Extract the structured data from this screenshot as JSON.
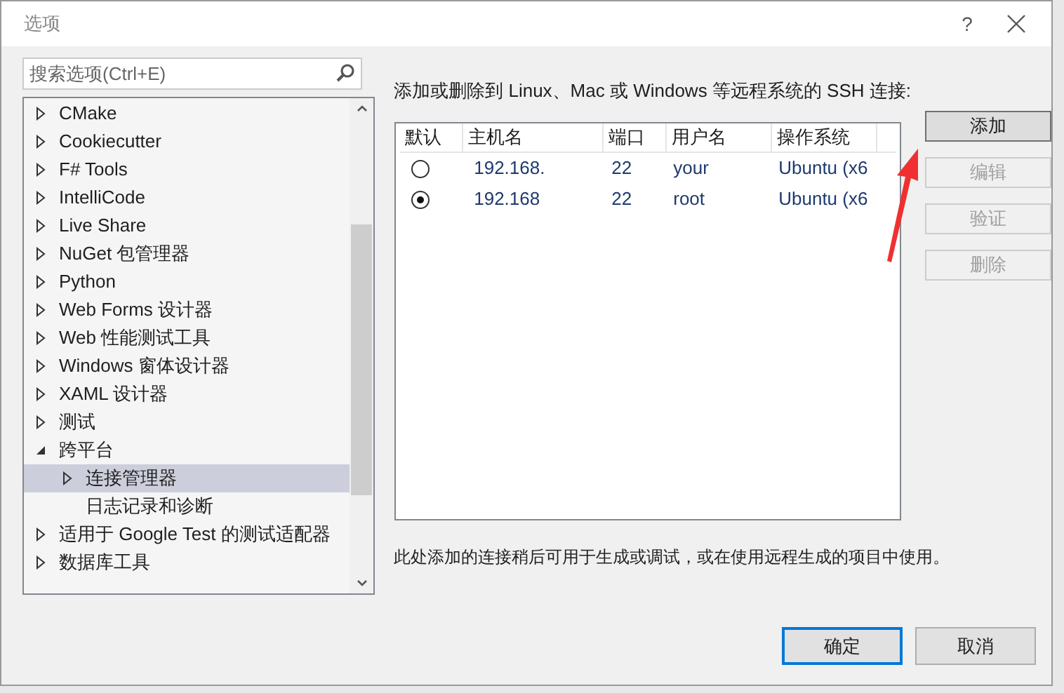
{
  "window": {
    "title": "选项",
    "help": "?"
  },
  "search": {
    "placeholder": "搜索选项(Ctrl+E)"
  },
  "tree": [
    {
      "label": "CMake",
      "kind": "group",
      "expanded": false,
      "selected": false
    },
    {
      "label": "Cookiecutter",
      "kind": "group",
      "expanded": false,
      "selected": false
    },
    {
      "label": "F# Tools",
      "kind": "group",
      "expanded": false,
      "selected": false
    },
    {
      "label": "IntelliCode",
      "kind": "group",
      "expanded": false,
      "selected": false
    },
    {
      "label": "Live Share",
      "kind": "group",
      "expanded": false,
      "selected": false
    },
    {
      "label": "NuGet 包管理器",
      "kind": "group",
      "expanded": false,
      "selected": false
    },
    {
      "label": "Python",
      "kind": "group",
      "expanded": false,
      "selected": false
    },
    {
      "label": "Web Forms 设计器",
      "kind": "group",
      "expanded": false,
      "selected": false
    },
    {
      "label": "Web 性能测试工具",
      "kind": "group",
      "expanded": false,
      "selected": false
    },
    {
      "label": "Windows 窗体设计器",
      "kind": "group",
      "expanded": false,
      "selected": false
    },
    {
      "label": "XAML 设计器",
      "kind": "group",
      "expanded": false,
      "selected": false
    },
    {
      "label": "测试",
      "kind": "group",
      "expanded": false,
      "selected": false
    },
    {
      "label": "跨平台",
      "kind": "group",
      "expanded": true,
      "selected": false,
      "children": [
        {
          "label": "连接管理器",
          "kind": "group",
          "expanded": false,
          "selected": true
        },
        {
          "label": "日志记录和诊断",
          "kind": "leaf",
          "expanded": false,
          "selected": false
        }
      ]
    },
    {
      "label": "适用于 Google Test 的测试适配器",
      "kind": "group",
      "expanded": false,
      "selected": false
    },
    {
      "label": "数据库工具",
      "kind": "group",
      "expanded": false,
      "selected": false
    }
  ],
  "intro": "添加或删除到 Linux、Mac 或 Windows 等远程系统的 SSH 连接:",
  "table": {
    "columns": [
      "默认",
      "主机名",
      "端口",
      "用户名",
      "操作系统"
    ],
    "rows": [
      {
        "selected": false,
        "host": "192.168.",
        "port": "22",
        "user": "your",
        "os": "Ubuntu (x6"
      },
      {
        "selected": true,
        "host": "192.168",
        "port": "22",
        "user": "root",
        "os": "Ubuntu (x6"
      }
    ]
  },
  "side_buttons": [
    {
      "label": "添加",
      "disabled": false
    },
    {
      "label": "编辑",
      "disabled": true
    },
    {
      "label": "验证",
      "disabled": true
    },
    {
      "label": "删除",
      "disabled": true
    }
  ],
  "note": "此处添加的连接稍后可用于生成或调试，或在使用远程生成的项目中使用。",
  "buttons": [
    {
      "label": "确定",
      "default": true
    },
    {
      "label": "取消",
      "default": false
    }
  ]
}
